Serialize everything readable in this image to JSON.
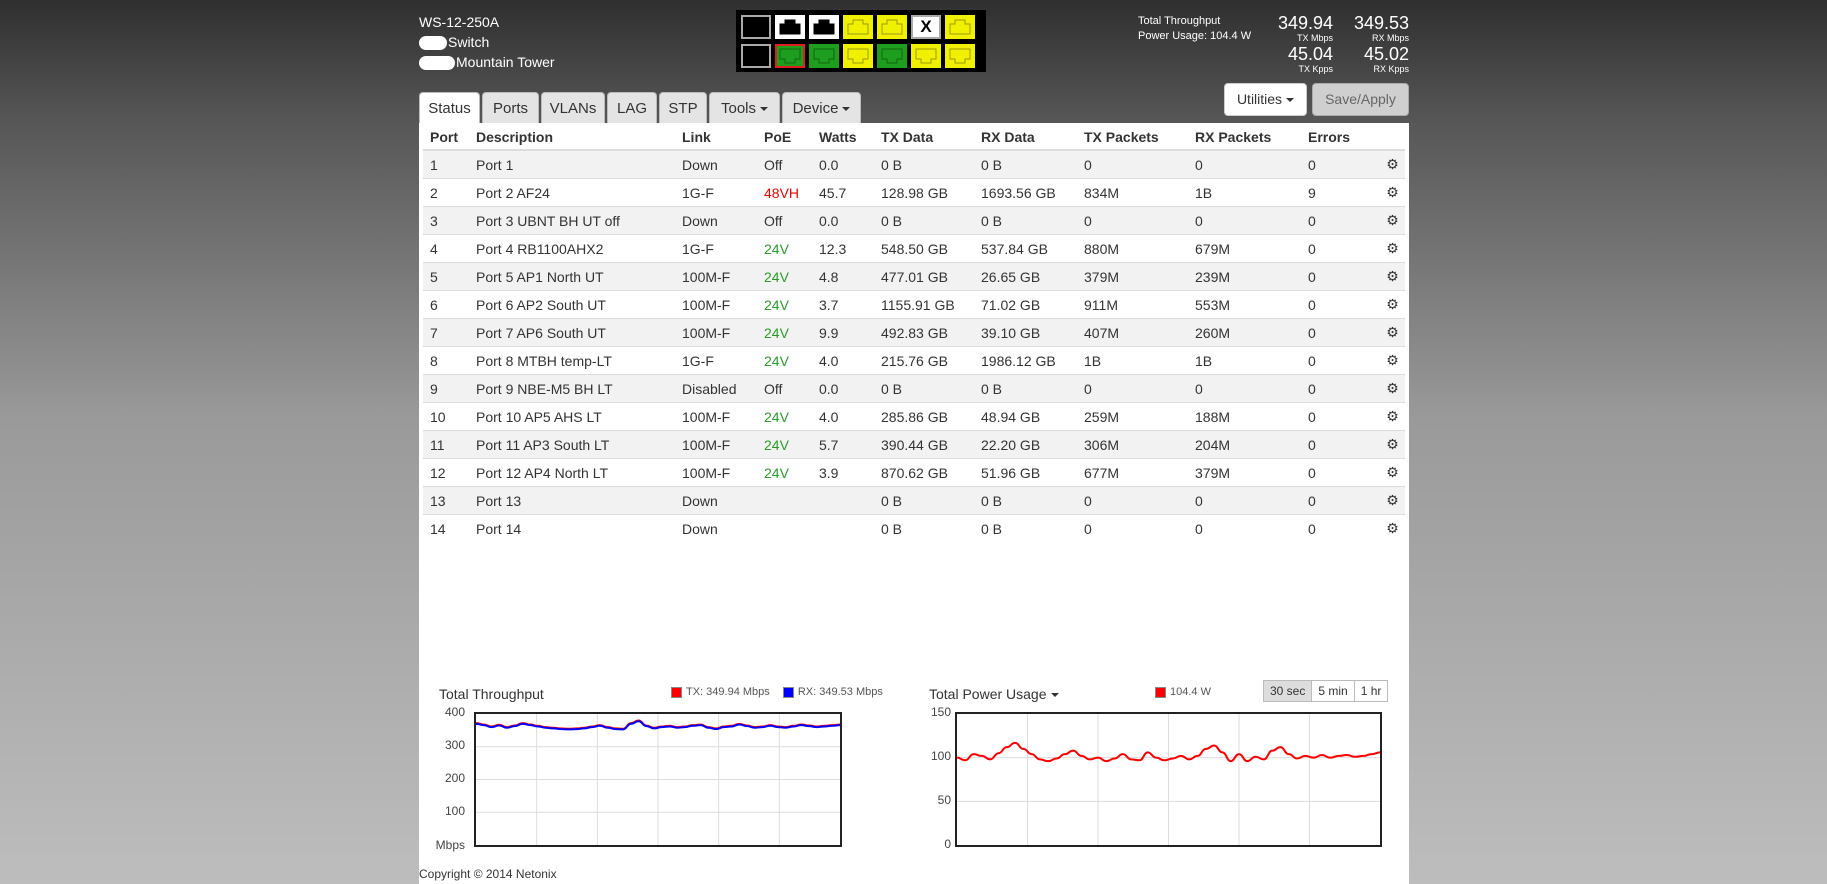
{
  "device": {
    "model": "WS-12-250A",
    "name": "Switch",
    "location": "Mountain Tower"
  },
  "throughput": {
    "label": "Total Throughput",
    "power_label": "Power Usage: 104.4 W",
    "tx_mbps": "349.94",
    "tx_mbps_unit": "TX Mbps",
    "rx_mbps": "349.53",
    "rx_mbps_unit": "RX Mbps",
    "tx_kpps": "45.04",
    "tx_kpps_unit": "TX Kpps",
    "rx_kpps": "45.02",
    "rx_kpps_unit": "RX Kpps"
  },
  "port_panel": {
    "top": [
      {
        "state": "empty-black"
      },
      {
        "state": "white"
      },
      {
        "state": "white"
      },
      {
        "state": "yellow"
      },
      {
        "state": "yellow"
      },
      {
        "state": "disabled",
        "mark": "X"
      },
      {
        "state": "yellow"
      }
    ],
    "bottom": [
      {
        "state": "empty-black"
      },
      {
        "state": "green-red"
      },
      {
        "state": "green"
      },
      {
        "state": "yellow"
      },
      {
        "state": "green"
      },
      {
        "state": "yellow"
      },
      {
        "state": "yellow"
      }
    ],
    "colors": {
      "yellow": "#f0f000",
      "green": "#1e9e1e",
      "white": "#ffffff",
      "red": "#e02020",
      "gray": "#aaaaaa"
    }
  },
  "buttons": {
    "utilities": "Utilities",
    "save_apply": "Save/Apply"
  },
  "tabs": [
    {
      "label": "Status",
      "active": true
    },
    {
      "label": "Ports"
    },
    {
      "label": "VLANs"
    },
    {
      "label": "LAG"
    },
    {
      "label": "STP"
    },
    {
      "label": "Tools",
      "dropdown": true
    },
    {
      "label": "Device",
      "dropdown": true
    }
  ],
  "table": {
    "headers": [
      "Port",
      "Description",
      "Link",
      "PoE",
      "Watts",
      "TX Data",
      "RX Data",
      "TX Packets",
      "RX Packets",
      "Errors"
    ],
    "rows": [
      {
        "port": "1",
        "desc": "Port 1",
        "link": "Down",
        "poe": "Off",
        "poe_color": "",
        "watts": "0.0",
        "tx": "0 B",
        "rx": "0 B",
        "txp": "0",
        "rxp": "0",
        "err": "0"
      },
      {
        "port": "2",
        "desc": "Port 2 AF24",
        "link": "1G-F",
        "poe": "48VH",
        "poe_color": "red",
        "watts": "45.7",
        "tx": "128.98 GB",
        "rx": "1693.56 GB",
        "txp": "834M",
        "rxp": "1B",
        "err": "9"
      },
      {
        "port": "3",
        "desc": "Port 3 UBNT BH UT off",
        "link": "Down",
        "poe": "Off",
        "poe_color": "",
        "watts": "0.0",
        "tx": "0 B",
        "rx": "0 B",
        "txp": "0",
        "rxp": "0",
        "err": "0"
      },
      {
        "port": "4",
        "desc": "Port 4 RB1100AHX2",
        "link": "1G-F",
        "poe": "24V",
        "poe_color": "green",
        "watts": "12.3",
        "tx": "548.50 GB",
        "rx": "537.84 GB",
        "txp": "880M",
        "rxp": "679M",
        "err": "0"
      },
      {
        "port": "5",
        "desc": "Port 5 AP1 North UT",
        "link": "100M-F",
        "poe": "24V",
        "poe_color": "green",
        "watts": "4.8",
        "tx": "477.01 GB",
        "rx": "26.65 GB",
        "txp": "379M",
        "rxp": "239M",
        "err": "0"
      },
      {
        "port": "6",
        "desc": "Port 6 AP2 South UT",
        "link": "100M-F",
        "poe": "24V",
        "poe_color": "green",
        "watts": "3.7",
        "tx": "1155.91 GB",
        "rx": "71.02 GB",
        "txp": "911M",
        "rxp": "553M",
        "err": "0"
      },
      {
        "port": "7",
        "desc": "Port 7 AP6 South UT",
        "link": "100M-F",
        "poe": "24V",
        "poe_color": "green",
        "watts": "9.9",
        "tx": "492.83 GB",
        "rx": "39.10 GB",
        "txp": "407M",
        "rxp": "260M",
        "err": "0"
      },
      {
        "port": "8",
        "desc": "Port 8 MTBH temp-LT",
        "link": "1G-F",
        "poe": "24V",
        "poe_color": "green",
        "watts": "4.0",
        "tx": "215.76 GB",
        "rx": "1986.12 GB",
        "txp": "1B",
        "rxp": "1B",
        "err": "0"
      },
      {
        "port": "9",
        "desc": "Port 9 NBE-M5 BH LT",
        "link": "Disabled",
        "poe": "Off",
        "poe_color": "",
        "watts": "0.0",
        "tx": "0 B",
        "rx": "0 B",
        "txp": "0",
        "rxp": "0",
        "err": "0"
      },
      {
        "port": "10",
        "desc": "Port 10 AP5 AHS LT",
        "link": "100M-F",
        "poe": "24V",
        "poe_color": "green",
        "watts": "4.0",
        "tx": "285.86 GB",
        "rx": "48.94 GB",
        "txp": "259M",
        "rxp": "188M",
        "err": "0"
      },
      {
        "port": "11",
        "desc": "Port 11 AP3 South LT",
        "link": "100M-F",
        "poe": "24V",
        "poe_color": "green",
        "watts": "5.7",
        "tx": "390.44 GB",
        "rx": "22.20 GB",
        "txp": "306M",
        "rxp": "204M",
        "err": "0"
      },
      {
        "port": "12",
        "desc": "Port 12 AP4 North LT",
        "link": "100M-F",
        "poe": "24V",
        "poe_color": "green",
        "watts": "3.9",
        "tx": "870.62 GB",
        "rx": "51.96 GB",
        "txp": "677M",
        "rxp": "379M",
        "err": "0"
      },
      {
        "port": "13",
        "desc": "Port 13",
        "link": "Down",
        "poe": "",
        "poe_color": "",
        "watts": "",
        "tx": "0 B",
        "rx": "0 B",
        "txp": "0",
        "rxp": "0",
        "err": "0"
      },
      {
        "port": "14",
        "desc": "Port 14",
        "link": "Down",
        "poe": "",
        "poe_color": "",
        "watts": "",
        "tx": "0 B",
        "rx": "0 B",
        "txp": "0",
        "rxp": "0",
        "err": "0"
      }
    ]
  },
  "charts_ui": {
    "throughput_title": "Total Throughput",
    "tx_legend": "TX: 349.94 Mbps",
    "rx_legend": "RX: 349.53 Mbps",
    "power_title": "Total Power Usage",
    "power_legend": "104.4 W",
    "ranges": [
      "30 sec",
      "5 min",
      "1 hr"
    ],
    "active_range": "30 sec"
  },
  "chart_data": [
    {
      "type": "line",
      "title": "Total Throughput",
      "ylabel": "Mbps",
      "ylim": [
        0,
        400
      ],
      "yticks": [
        "400",
        "300",
        "200",
        "100"
      ],
      "grid": true,
      "series": [
        {
          "name": "TX",
          "color": "#ff0000",
          "values": [
            372,
            368,
            362,
            367,
            360,
            365,
            372,
            368,
            364,
            360,
            358,
            356,
            355,
            356,
            358,
            362,
            366,
            360,
            356,
            355,
            372,
            380,
            365,
            358,
            362,
            364,
            360,
            362,
            366,
            368,
            360,
            356,
            362,
            364,
            370,
            365,
            360,
            362,
            366,
            362,
            360,
            364,
            368,
            365,
            362,
            364,
            366,
            368
          ]
        },
        {
          "name": "RX",
          "color": "#0000ff",
          "values": [
            370,
            366,
            360,
            365,
            358,
            363,
            370,
            366,
            362,
            358,
            356,
            354,
            353,
            354,
            356,
            360,
            364,
            358,
            354,
            353,
            370,
            378,
            363,
            356,
            360,
            362,
            358,
            360,
            364,
            366,
            358,
            354,
            360,
            362,
            368,
            363,
            358,
            360,
            364,
            360,
            358,
            362,
            366,
            363,
            360,
            362,
            364,
            366
          ]
        }
      ]
    },
    {
      "type": "line",
      "title": "Total Power Usage",
      "ylim": [
        0,
        150
      ],
      "yticks": [
        "150",
        "100",
        "50",
        "0"
      ],
      "grid": true,
      "series": [
        {
          "name": "104.4 W",
          "color": "#ff0000",
          "values": [
            100,
            97,
            104,
            102,
            98,
            105,
            112,
            117,
            110,
            104,
            98,
            96,
            99,
            104,
            108,
            102,
            98,
            100,
            96,
            99,
            104,
            98,
            97,
            106,
            100,
            97,
            99,
            102,
            98,
            102,
            110,
            114,
            106,
            96,
            104,
            96,
            101,
            98,
            108,
            112,
            104,
            99,
            102,
            100,
            103,
            100,
            102,
            103,
            101,
            102,
            104,
            106
          ]
        }
      ]
    }
  ],
  "footer": {
    "copyright": "Copyright © 2014 Netonix"
  }
}
